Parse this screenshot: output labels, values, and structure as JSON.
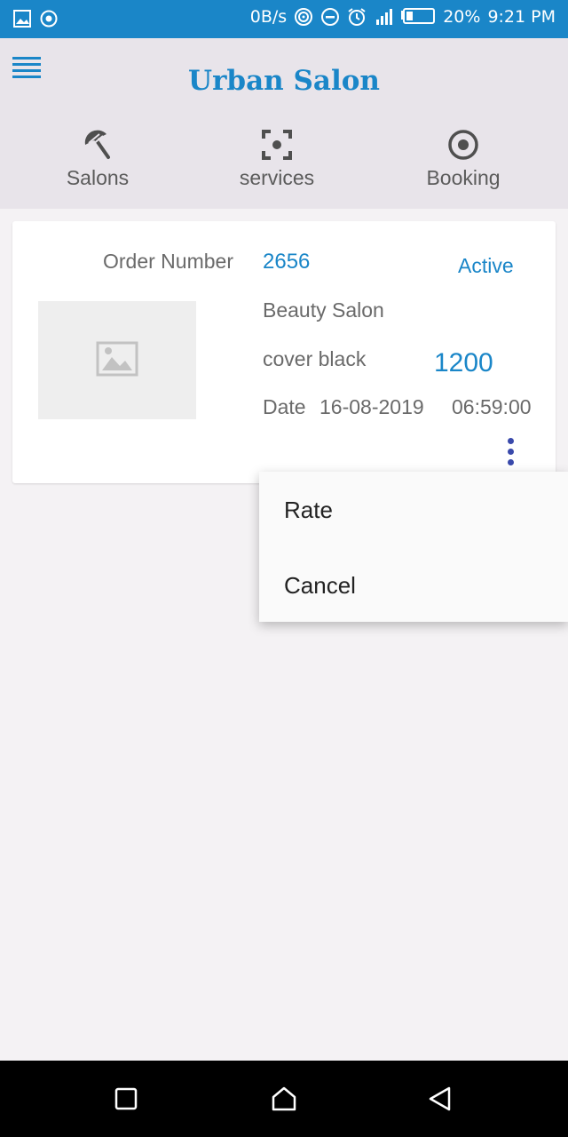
{
  "status_bar": {
    "net_speed": "0B/s",
    "battery": "20%",
    "time": "9:21 PM",
    "icons": [
      "gallery-icon",
      "record-icon",
      "hotspot-icon",
      "dnd-icon",
      "alarm-icon",
      "signal-icon",
      "battery-icon"
    ]
  },
  "header": {
    "title": "Urban Salon",
    "menu_icon": "hamburger-menu-icon",
    "accent_color": "#1a86c8",
    "tabs": [
      {
        "label": "Salons",
        "icon": "salon-umbrella-icon"
      },
      {
        "label": "services",
        "icon": "focus-target-icon"
      },
      {
        "label": "Booking",
        "icon": "radio-target-icon"
      }
    ]
  },
  "order": {
    "order_number_label": "Order Number",
    "order_number": "2656",
    "status": "Active",
    "salon_name": "Beauty Salon",
    "service": "cover black",
    "price": "1200",
    "date_label": "Date",
    "date": "16-08-2019",
    "time": "06:59:00",
    "image_icon": "image-placeholder-icon",
    "more_icon": "more-vert-icon"
  },
  "popup_menu": {
    "items": [
      {
        "label": "Rate"
      },
      {
        "label": "Cancel"
      }
    ]
  },
  "nav_bar": {
    "icons": [
      "recents-square-icon",
      "home-icon",
      "back-triangle-icon"
    ]
  }
}
